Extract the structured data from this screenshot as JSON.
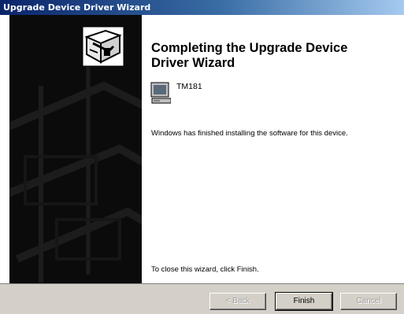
{
  "window": {
    "title": "Upgrade Device Driver Wizard"
  },
  "main": {
    "heading": "Completing the Upgrade Device Driver Wizard",
    "device_name": "TM181",
    "status_text": "Windows has finished installing the software for this device.",
    "close_instruction": "To close this wizard, click Finish."
  },
  "buttons": {
    "back_label": "< Back",
    "finish_label": "Finish",
    "cancel_label": "Cancel"
  },
  "icons": {
    "wizard_icon": "hardware-box-icon",
    "device_icon": "monitor-icon"
  },
  "colors": {
    "title_bar": "#0a246a",
    "left_panel": "#0b0b0b",
    "dialog_face": "#d4d0c8"
  }
}
